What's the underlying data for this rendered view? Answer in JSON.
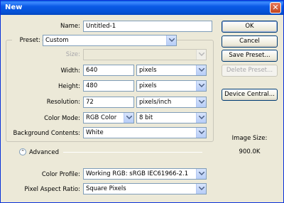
{
  "window": {
    "title": "New"
  },
  "form": {
    "name_label": "Name:",
    "name_value": "Untitled-1",
    "preset_label": "Preset:",
    "preset_value": "Custom",
    "size_label": "Size:",
    "size_value": "",
    "width_label": "Width:",
    "width_value": "640",
    "width_unit": "pixels",
    "height_label": "Height:",
    "height_value": "480",
    "height_unit": "pixels",
    "resolution_label": "Resolution:",
    "resolution_value": "72",
    "resolution_unit": "pixels/inch",
    "color_mode_label": "Color Mode:",
    "color_mode_value": "RGB Color",
    "bit_depth_value": "8 bit",
    "background_label": "Background Contents:",
    "background_value": "White",
    "advanced_label": "Advanced",
    "color_profile_label": "Color Profile:",
    "color_profile_value": "Working RGB:  sRGB IEC61966-2.1",
    "pixel_aspect_label": "Pixel Aspect Ratio:",
    "pixel_aspect_value": "Square Pixels"
  },
  "buttons": {
    "ok": "OK",
    "cancel": "Cancel",
    "save_preset": "Save Preset...",
    "delete_preset": "Delete Preset...",
    "device_central": "Device Central..."
  },
  "image_size": {
    "label": "Image Size:",
    "value": "900.0K"
  },
  "icons": {
    "close": "close-icon",
    "dropdown": "chevron-down-icon",
    "advanced": "collapse-chevron-icon"
  },
  "colors": {
    "titlebar": "#0a5ae6",
    "dialog_bg": "#ece9d8",
    "field_border": "#7f9db9"
  }
}
